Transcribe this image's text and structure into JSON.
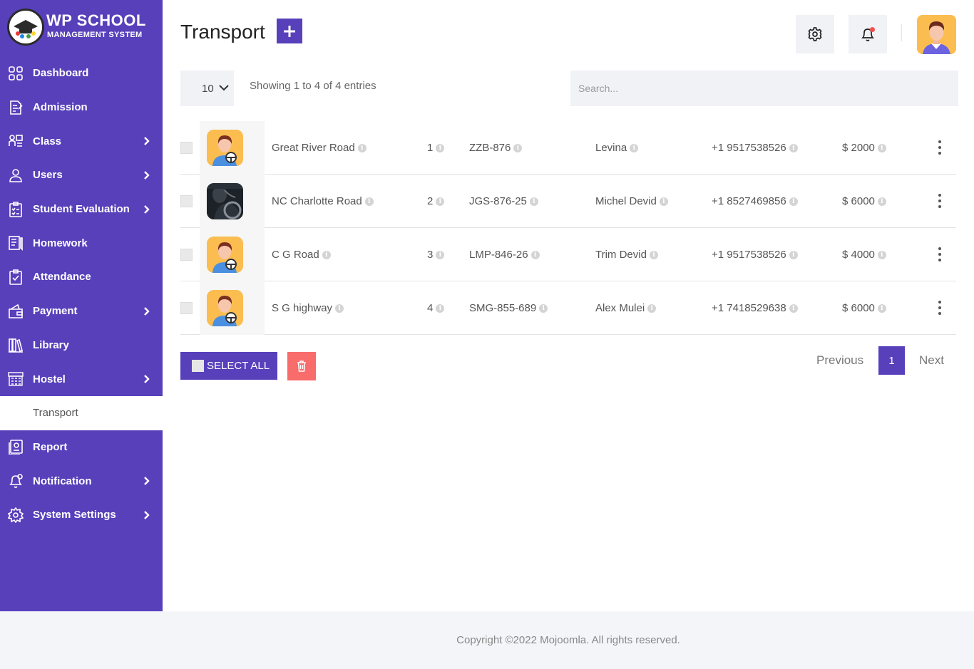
{
  "brand": {
    "title": "WP SCHOOL",
    "subtitle": "MANAGEMENT SYSTEM"
  },
  "sidebar": {
    "items": [
      {
        "label": "Dashboard",
        "icon": "dashboard-icon",
        "has_submenu": false
      },
      {
        "label": "Admission",
        "icon": "admission-icon",
        "has_submenu": false
      },
      {
        "label": "Class",
        "icon": "class-icon",
        "has_submenu": true
      },
      {
        "label": "Users",
        "icon": "user-icon",
        "has_submenu": true
      },
      {
        "label": "Student Evaluation",
        "icon": "evaluation-icon",
        "has_submenu": true
      },
      {
        "label": "Homework",
        "icon": "homework-icon",
        "has_submenu": false
      },
      {
        "label": "Attendance",
        "icon": "attendance-icon",
        "has_submenu": false
      },
      {
        "label": "Payment",
        "icon": "payment-icon",
        "has_submenu": true
      },
      {
        "label": "Library",
        "icon": "library-icon",
        "has_submenu": false
      },
      {
        "label": "Hostel",
        "icon": "hostel-icon",
        "has_submenu": true
      },
      {
        "label": "Transport",
        "icon": "transport-icon",
        "has_submenu": false,
        "active": true
      },
      {
        "label": "Report",
        "icon": "report-icon",
        "has_submenu": false
      },
      {
        "label": "Notification",
        "icon": "notification-icon",
        "has_submenu": true
      },
      {
        "label": "System Settings",
        "icon": "settings-icon",
        "has_submenu": true
      }
    ]
  },
  "header": {
    "title": "Transport",
    "add_label": "+"
  },
  "table_controls": {
    "page_length": "10",
    "info": "Showing 1 to 4 of 4 entries",
    "search_placeholder": "Search..."
  },
  "rows": [
    {
      "route": "Great River Road",
      "number": "1",
      "vehicle": "ZZB-876",
      "driver": "Levina",
      "phone": "+1 9517538526",
      "fare": "$ 2000",
      "image": "driver-avatar"
    },
    {
      "route": "NC Charlotte Road",
      "number": "2",
      "vehicle": "JGS-876-25",
      "driver": "Michel Devid",
      "phone": "+1 8527469856",
      "fare": "$ 6000",
      "image": "driver-photo"
    },
    {
      "route": "C G Road",
      "number": "3",
      "vehicle": "LMP-846-26",
      "driver": "Trim Devid",
      "phone": "+1 9517538526",
      "fare": "$ 4000",
      "image": "driver-avatar"
    },
    {
      "route": "S G highway",
      "number": "4",
      "vehicle": "SMG-855-689",
      "driver": "Alex Mulei",
      "phone": "+1 7418529638",
      "fare": "$ 6000",
      "image": "driver-avatar"
    }
  ],
  "actions": {
    "select_all": "SELECT ALL"
  },
  "pagination": {
    "previous": "Previous",
    "current": "1",
    "next": "Next"
  },
  "footer": {
    "copyright": "Copyright ©2022 Mojoomla. All rights reserved."
  },
  "colors": {
    "primary": "#5840bb",
    "danger": "#f86c6b",
    "accent_avatar": "#fbbd50",
    "notification_dot": "#f44e4e"
  }
}
